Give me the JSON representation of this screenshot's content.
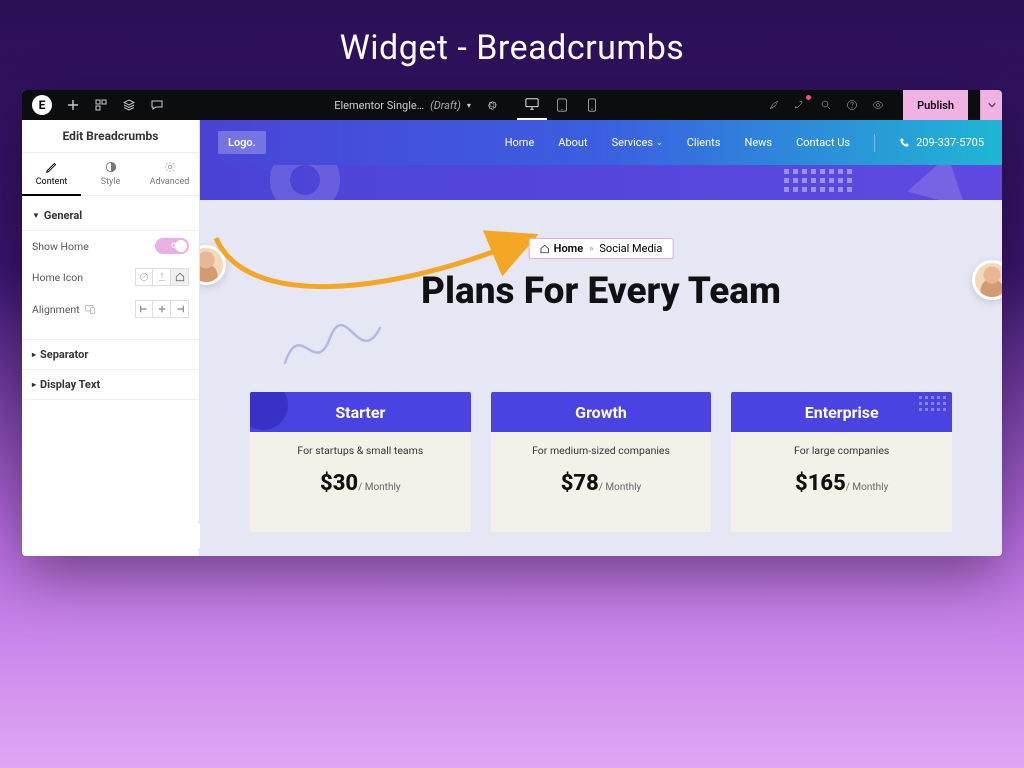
{
  "page_title": "Widget - Breadcrumbs",
  "topbar": {
    "doc_name": "Elementor Single…",
    "doc_status": "(Draft)",
    "publish_label": "Publish"
  },
  "sidebar": {
    "panel_title": "Edit Breadcrumbs",
    "tabs": {
      "content": "Content",
      "style": "Style",
      "advanced": "Advanced"
    },
    "sections": {
      "general": "General",
      "separator": "Separator",
      "display_text": "Display Text"
    },
    "fields": {
      "show_home_label": "Show Home",
      "show_home_value": "On",
      "home_icon_label": "Home Icon",
      "alignment_label": "Alignment"
    }
  },
  "site": {
    "logo": "Logo.",
    "nav": {
      "home": "Home",
      "about": "About",
      "services": "Services",
      "clients": "Clients",
      "news": "News",
      "contact": "Contact Us"
    },
    "phone": "209-337-5705"
  },
  "breadcrumb": {
    "home": "Home",
    "sep": "»",
    "current": "Social Media"
  },
  "plans_heading": "Plans For Every Team",
  "plans": [
    {
      "name": "Starter",
      "desc": "For startups & small teams",
      "price": "$30",
      "per": "/ Monthly"
    },
    {
      "name": "Growth",
      "desc": "For medium-sized companies",
      "price": "$78",
      "per": "/ Monthly"
    },
    {
      "name": "Enterprise",
      "desc": "For large companies",
      "price": "$165",
      "per": "/ Monthly"
    }
  ]
}
